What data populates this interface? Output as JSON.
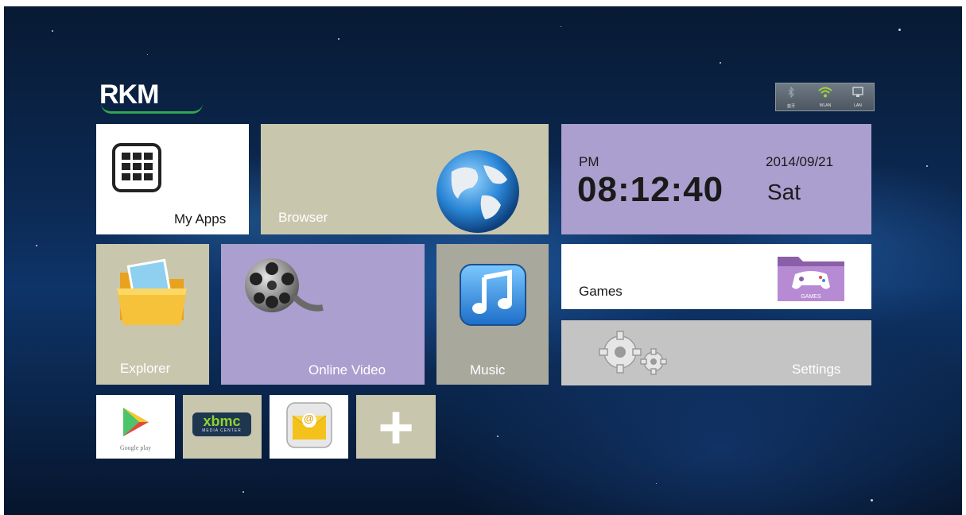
{
  "brand": {
    "logo_text": "RKM"
  },
  "status_bar": {
    "items": [
      {
        "icon": "bluetooth-icon",
        "label": "蓝牙",
        "color": "#9aa6b0"
      },
      {
        "icon": "wifi-icon",
        "label": "WLAN",
        "color": "#9fd23a"
      },
      {
        "icon": "lan-icon",
        "label": "LAN",
        "color": "#d0d6dc"
      }
    ]
  },
  "tiles": {
    "my_apps": {
      "label": "My Apps",
      "bg": "#ffffff"
    },
    "browser": {
      "label": "Browser",
      "bg": "#c9c6ae"
    },
    "clock": {
      "ampm": "PM",
      "time": "08:12:40",
      "date": "2014/09/21",
      "weekday": "Sat",
      "bg": "#ab9fcf"
    },
    "explorer": {
      "label": "Explorer",
      "bg": "#c9c6ae"
    },
    "online_video": {
      "label": "Online Video",
      "bg": "#ab9fcf"
    },
    "music": {
      "label": "Music",
      "bg": "#a9a89d"
    },
    "games": {
      "label": "Games",
      "bg": "#ffffff"
    },
    "settings": {
      "label": "Settings",
      "bg": "#c4c4c4"
    }
  },
  "shortcuts": [
    {
      "name": "google-play",
      "caption": "Google play",
      "bg": "#ffffff"
    },
    {
      "name": "xbmc",
      "caption": "xbmc",
      "subcaption": "MEDIA CENTER",
      "bg": "#c9c6ae"
    },
    {
      "name": "email",
      "caption": "@",
      "bg": "#ffffff"
    },
    {
      "name": "add",
      "caption": "+",
      "bg": "#c9c6ae"
    }
  ],
  "colors": {
    "accent_purple": "#ab9fcf",
    "accent_beige": "#c9c6ae",
    "games_badge_text": "GAMES"
  }
}
